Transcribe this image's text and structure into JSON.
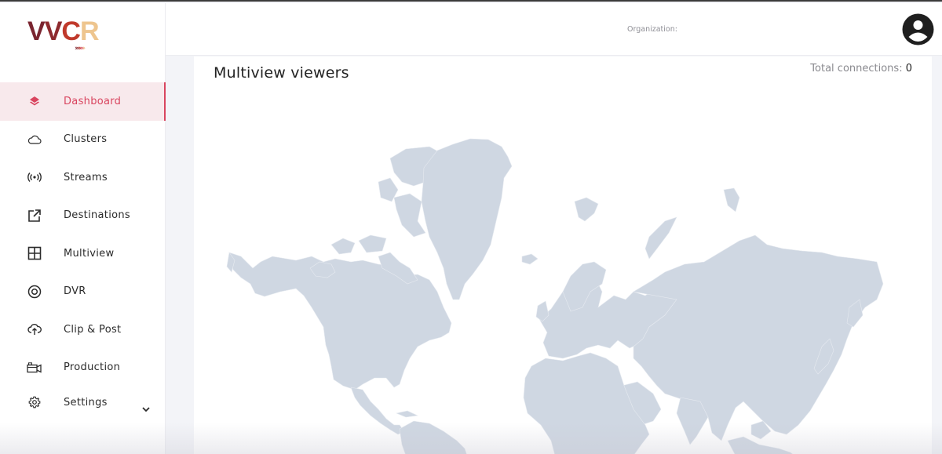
{
  "logo": {
    "text": "VVCR",
    "letters": [
      {
        "char": "V",
        "color": "#7a2530"
      },
      {
        "char": "V",
        "color": "#8e2a2e"
      },
      {
        "char": "C",
        "color": "#c0392b"
      },
      {
        "char": "R",
        "color": "#eec58e"
      }
    ],
    "chevrons": "›››››››"
  },
  "sidebar": {
    "items": [
      {
        "label": "Dashboard",
        "icon": "layers-icon",
        "active": true
      },
      {
        "label": "Clusters",
        "icon": "cloud-icon"
      },
      {
        "label": "Streams",
        "icon": "broadcast-icon"
      },
      {
        "label": "Destinations",
        "icon": "external-link-icon"
      },
      {
        "label": "Multiview",
        "icon": "grid-icon"
      },
      {
        "label": "DVR",
        "icon": "record-icon"
      },
      {
        "label": "Clip & Post",
        "icon": "cloud-upload-icon"
      },
      {
        "label": "Production",
        "icon": "video-camera-icon"
      },
      {
        "label": "Settings",
        "icon": "gear-icon",
        "expandable": true
      }
    ]
  },
  "header": {
    "organization_label": "Organization:",
    "avatar_icon": "user-avatar-icon"
  },
  "main": {
    "title": "Multiview viewers",
    "total_connections_label": "Total connections:",
    "total_connections_value": "0",
    "map": {
      "land_color": "#cfd7e2",
      "border_color": "#e6eaf0"
    }
  },
  "colors": {
    "accent": "#d9455f",
    "active_bg": "#f8e9ec",
    "page_bg": "#f3f4f8"
  }
}
